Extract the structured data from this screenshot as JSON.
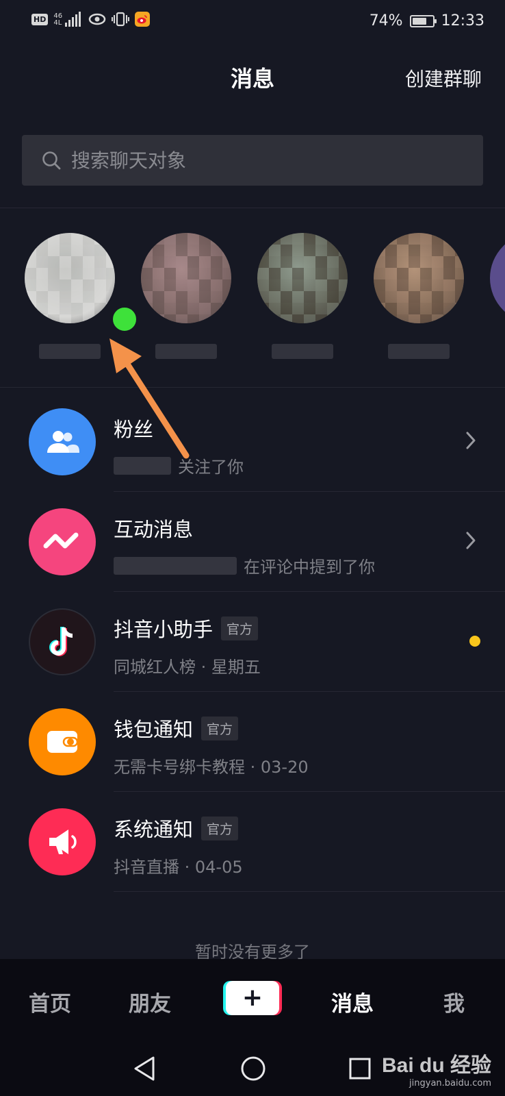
{
  "status_bar": {
    "hd": "HD",
    "signal_top": "46",
    "signal_bottom": "4L",
    "battery_percent": "74%",
    "battery_level": 0.74,
    "time": "12:33"
  },
  "header": {
    "title": "消息",
    "create_group": "创建群聊"
  },
  "search": {
    "placeholder": "搜索聊天对象"
  },
  "stories": [
    {
      "online": true,
      "colors": [
        "#d8d8d6",
        "#b8b9b6"
      ]
    },
    {
      "online": false,
      "colors": [
        "#6e5a58",
        "#a8898a"
      ]
    },
    {
      "online": false,
      "colors": [
        "#4d4a40",
        "#8f9b8e"
      ]
    },
    {
      "online": false,
      "colors": [
        "#6a5546",
        "#b4937a"
      ]
    }
  ],
  "messages": [
    {
      "title": "粉丝",
      "official": false,
      "subtitle": "关注了你",
      "trailing": "chevron",
      "icon": "fans-icon",
      "icon_color": "#3f8ef5"
    },
    {
      "title": "互动消息",
      "official": false,
      "subtitle": "在评论中提到了你",
      "trailing": "chevron",
      "icon": "interaction-icon",
      "icon_color": "#f5457e"
    },
    {
      "title": "抖音小助手",
      "official": true,
      "subtitle": "同城红人榜 · 星期五",
      "trailing": "dot",
      "icon": "douyin-icon",
      "icon_color": "#20151b"
    },
    {
      "title": "钱包通知",
      "official": true,
      "subtitle": "无需卡号绑卡教程 · 03-20",
      "trailing": "none",
      "icon": "wallet-icon",
      "icon_color": "#fe8a00"
    },
    {
      "title": "系统通知",
      "official": true,
      "subtitle": "抖音直播 · 04-05",
      "trailing": "none",
      "icon": "megaphone-icon",
      "icon_color": "#fe2c55"
    }
  ],
  "official_tag": "官方",
  "no_more": "暂时没有更多了",
  "bottom_nav": {
    "home": "首页",
    "friends": "朋友",
    "plus": "+",
    "messages": "消息",
    "me": "我"
  },
  "watermark": {
    "logo": "Bai du 经验",
    "url": "jingyan.baidu.com"
  },
  "colors": {
    "background": "#161823",
    "online": "#3ee13a",
    "unread": "#f9c61c",
    "arrow": "#f4924a"
  }
}
